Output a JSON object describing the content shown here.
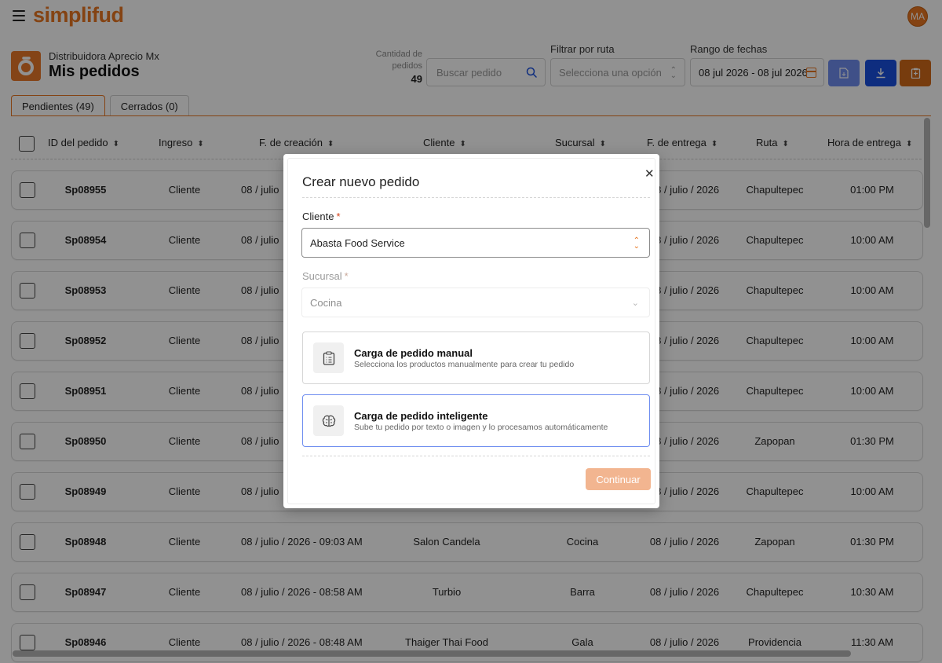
{
  "app": {
    "logo": "simplifud",
    "avatar_initials": "MA"
  },
  "header": {
    "company": "Distribuidora Aprecio Mx",
    "title": "Mis pedidos",
    "count_label": "Cantidad de pedidos",
    "count_value": "49"
  },
  "filters": {
    "search_placeholder": "Buscar pedido",
    "route_label": "Filtrar por ruta",
    "route_placeholder": "Selecciona una opción",
    "date_label": "Rango de fechas",
    "date_value": "08 jul 2026 - 08 jul 2026"
  },
  "toolbar": {
    "icons": [
      "file-icon",
      "download-icon",
      "clipboard-icon"
    ],
    "colors": {
      "file": "#6f8ef0",
      "download": "#1a4fe0",
      "clipboard": "#d16a1a"
    }
  },
  "tabs": [
    {
      "label": "Pendientes (49)",
      "active": true
    },
    {
      "label": "Cerrados (0)",
      "active": false
    }
  ],
  "table": {
    "columns": [
      "ID del pedido",
      "Ingreso",
      "F. de creación",
      "Cliente",
      "Sucursal",
      "F. de entrega",
      "Ruta",
      "Hora de entrega"
    ],
    "rows": [
      {
        "id": "Sp08955",
        "ingreso": "Cliente",
        "creacion": "08 / julio",
        "cliente": "",
        "sucursal": "",
        "entrega": "08 / julio / 2026",
        "ruta": "Chapultepec",
        "hora": "01:00 PM"
      },
      {
        "id": "Sp08954",
        "ingreso": "Cliente",
        "creacion": "08 / julio",
        "cliente": "",
        "sucursal": "",
        "entrega": "08 / julio / 2026",
        "ruta": "Chapultepec",
        "hora": "10:00 AM"
      },
      {
        "id": "Sp08953",
        "ingreso": "Cliente",
        "creacion": "08 / julio",
        "cliente": "",
        "sucursal": "",
        "entrega": "08 / julio / 2026",
        "ruta": "Chapultepec",
        "hora": "10:00 AM"
      },
      {
        "id": "Sp08952",
        "ingreso": "Cliente",
        "creacion": "08 / julio",
        "cliente": "",
        "sucursal": "",
        "entrega": "08 / julio / 2026",
        "ruta": "Chapultepec",
        "hora": "10:00 AM"
      },
      {
        "id": "Sp08951",
        "ingreso": "Cliente",
        "creacion": "08 / julio",
        "cliente": "",
        "sucursal": "",
        "entrega": "08 / julio / 2026",
        "ruta": "Chapultepec",
        "hora": "10:00 AM"
      },
      {
        "id": "Sp08950",
        "ingreso": "Cliente",
        "creacion": "08 / julio",
        "cliente": "",
        "sucursal": "",
        "entrega": "08 / julio / 2026",
        "ruta": "Zapopan",
        "hora": "01:30 PM"
      },
      {
        "id": "Sp08949",
        "ingreso": "Cliente",
        "creacion": "08 / julio",
        "cliente": "",
        "sucursal": "",
        "entrega": "08 / julio / 2026",
        "ruta": "Chapultepec",
        "hora": "10:00 AM"
      },
      {
        "id": "Sp08948",
        "ingreso": "Cliente",
        "creacion": "08 / julio / 2026 - 09:03 AM",
        "cliente": "Salon Candela",
        "sucursal": "Cocina",
        "entrega": "08 / julio / 2026",
        "ruta": "Zapopan",
        "hora": "01:30 PM"
      },
      {
        "id": "Sp08947",
        "ingreso": "Cliente",
        "creacion": "08 / julio / 2026 - 08:58 AM",
        "cliente": "Turbio",
        "sucursal": "Barra",
        "entrega": "08 / julio / 2026",
        "ruta": "Chapultepec",
        "hora": "10:30 AM"
      },
      {
        "id": "Sp08946",
        "ingreso": "Cliente",
        "creacion": "08 / julio / 2026 - 08:48 AM",
        "cliente": "Thaiger Thai Food",
        "sucursal": "Gala",
        "entrega": "08 / julio / 2026",
        "ruta": "Providencia",
        "hora": "11:30 AM"
      }
    ]
  },
  "modal": {
    "title": "Crear nuevo pedido",
    "client_label": "Cliente",
    "client_value": "Abasta Food Service",
    "branch_label": "Sucursal",
    "branch_value": "Cocina",
    "required_mark": "*",
    "options": [
      {
        "title": "Carga de pedido manual",
        "desc": "Selecciona los productos manualmente para crear tu pedido",
        "icon": "clipboard-list-icon"
      },
      {
        "title": "Carga de pedido inteligente",
        "desc": "Sube tu pedido por texto o imagen y lo procesamos automáticamente",
        "icon": "brain-icon"
      }
    ],
    "continue_label": "Continuar"
  }
}
